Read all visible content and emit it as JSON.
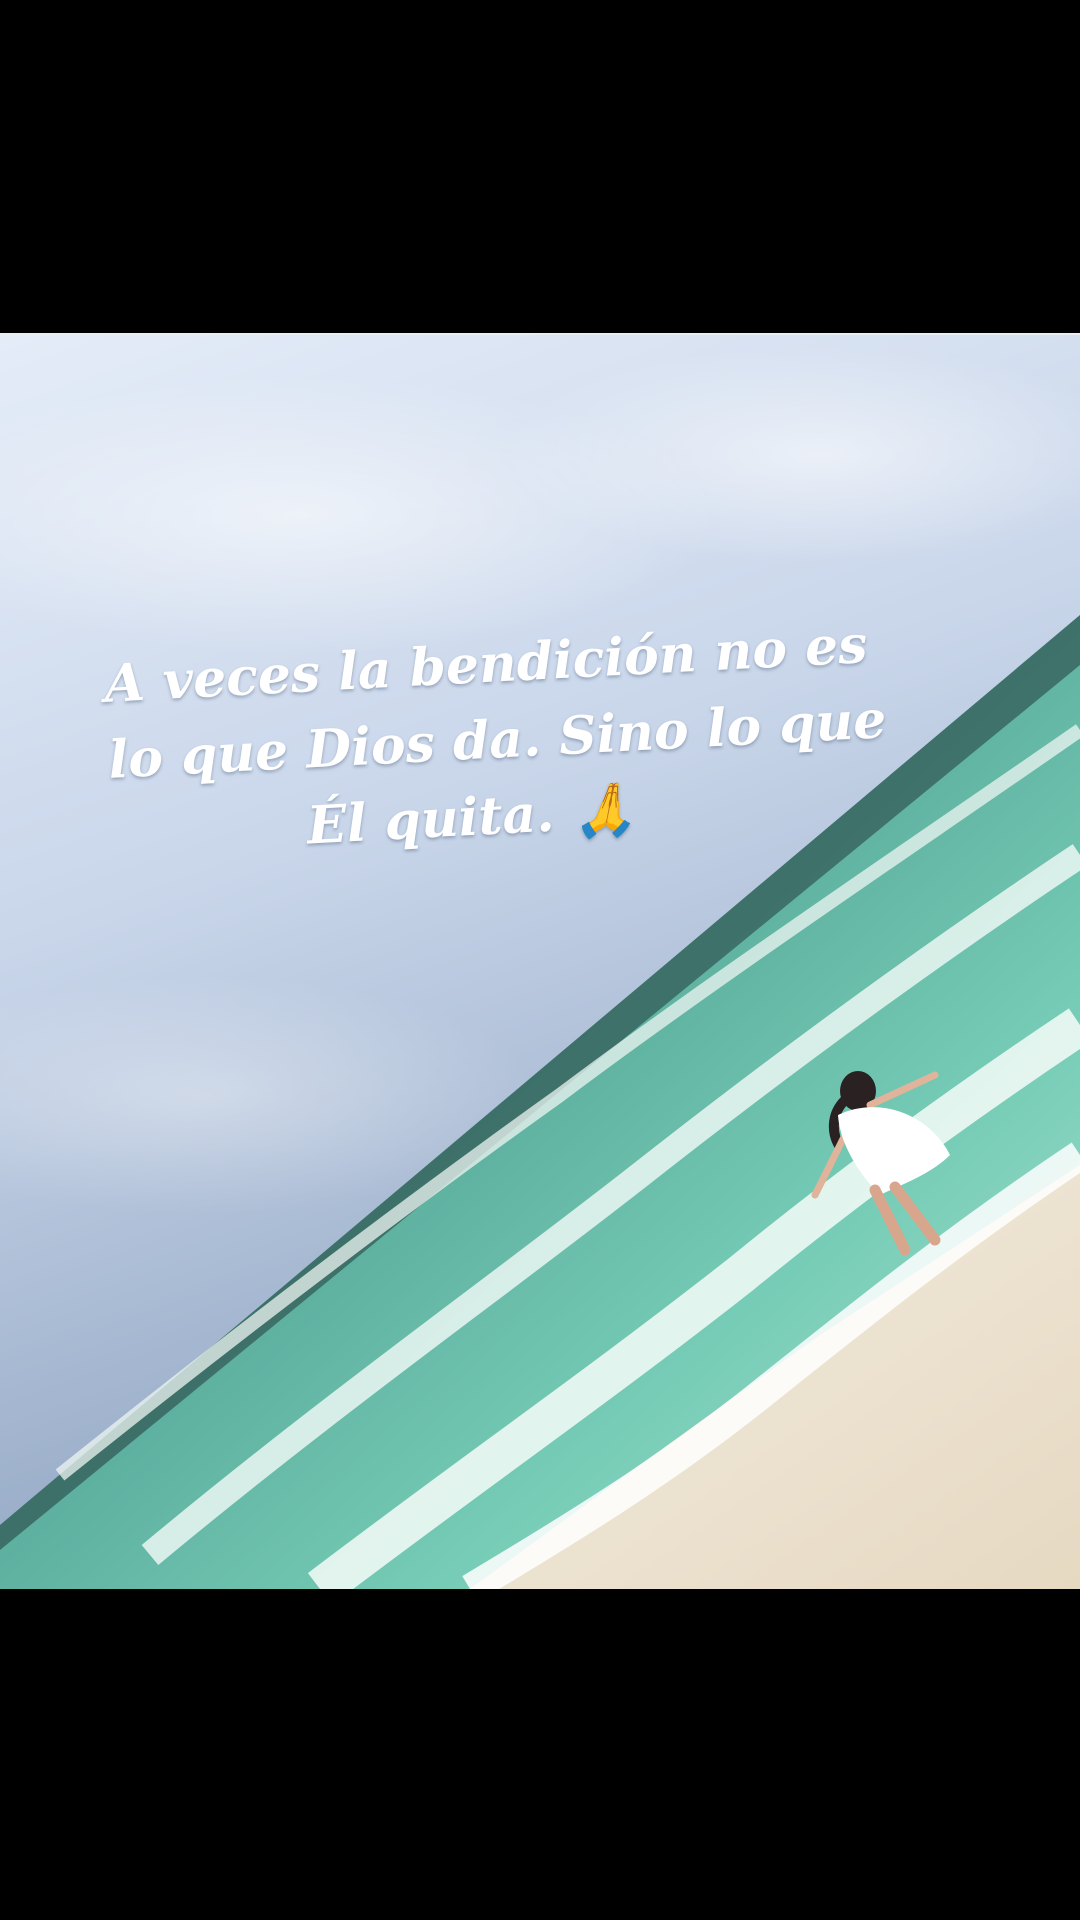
{
  "caption": {
    "line1": "A veces la bendición no es",
    "line2": "lo que Dios da. Sino lo que",
    "line3": "Él quita. 🙏"
  },
  "colors": {
    "letterbox": "#000000",
    "sky_top": "#d6e2f3",
    "sky_bottom": "#7f95b3",
    "sea_deep": "#3f7a78",
    "sea_mid": "#5fbfa8",
    "sea_shallow": "#a9e3d2",
    "foam": "#f2f7f4",
    "sand": "#efe6d6",
    "caption_text": "#ffffff"
  }
}
